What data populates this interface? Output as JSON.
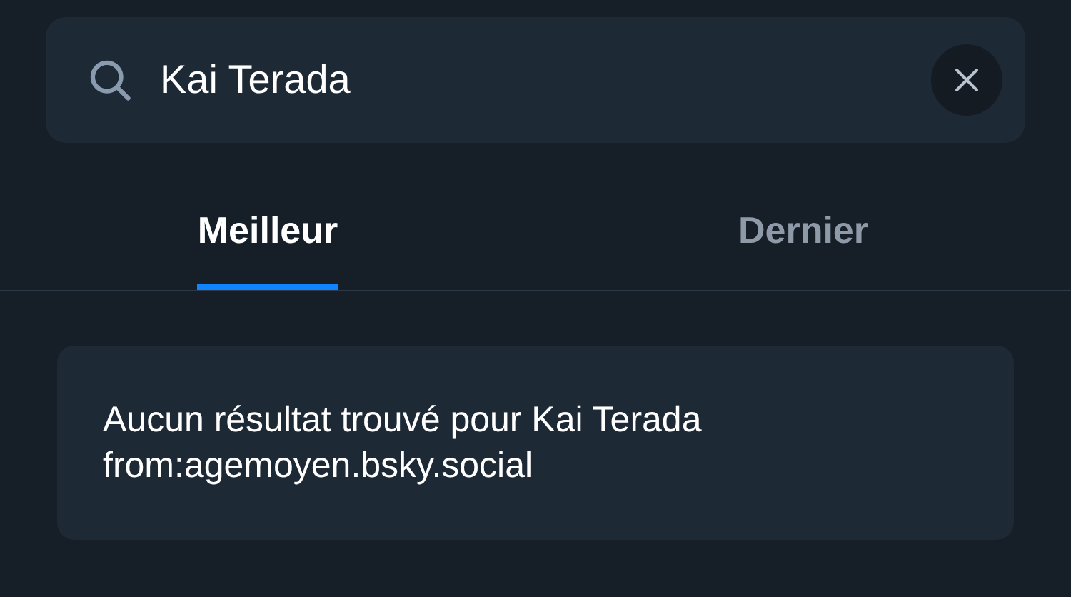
{
  "search": {
    "value": "Kai Terada"
  },
  "tabs": [
    {
      "label": "Meilleur",
      "selected": true
    },
    {
      "label": "Dernier",
      "selected": false
    }
  ],
  "empty_message": "Aucun résultat trouvé pour Kai Terada from:agemoyen.bsky.social"
}
